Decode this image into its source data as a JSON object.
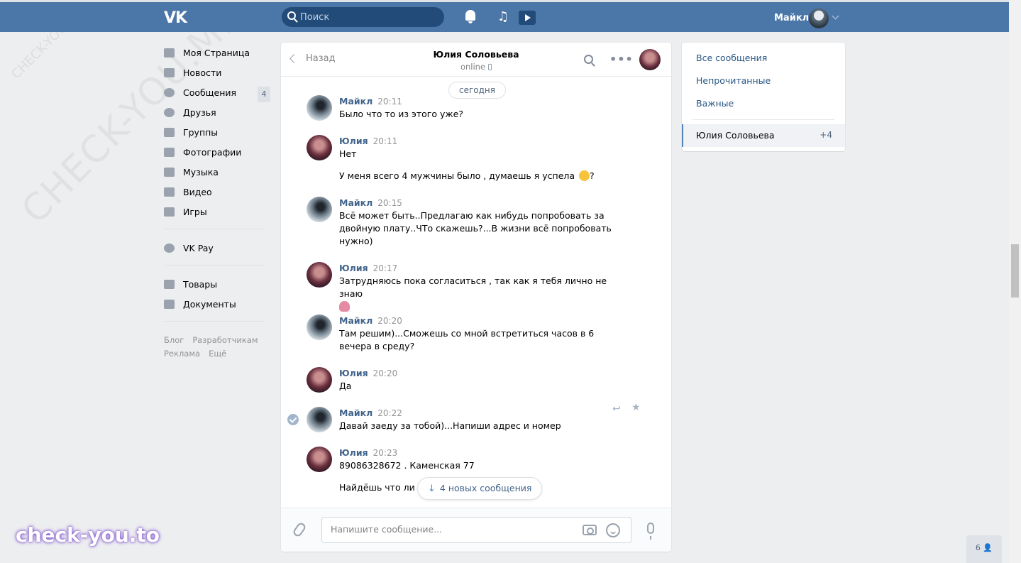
{
  "header": {
    "logo": "VK",
    "search_placeholder": "Поиск",
    "user_name": "Майкл",
    "icons": [
      "bell-icon",
      "music-icon",
      "player-icon"
    ]
  },
  "leftnav": {
    "items": [
      {
        "label": "Моя Страница",
        "icon": "home-icon"
      },
      {
        "label": "Новости",
        "icon": "news-icon"
      },
      {
        "label": "Сообщения",
        "icon": "messages-icon",
        "badge": "4"
      },
      {
        "label": "Друзья",
        "icon": "friends-icon"
      },
      {
        "label": "Группы",
        "icon": "groups-icon"
      },
      {
        "label": "Фотографии",
        "icon": "photo-icon"
      },
      {
        "label": "Музыка",
        "icon": "music-icon"
      },
      {
        "label": "Видео",
        "icon": "video-icon"
      },
      {
        "label": "Игры",
        "icon": "games-icon"
      },
      {
        "label": "VK Pay",
        "icon": "vkpay-icon"
      },
      {
        "label": "Товары",
        "icon": "goods-icon"
      },
      {
        "label": "Документы",
        "icon": "docs-icon"
      }
    ],
    "footer": [
      "Блог",
      "Разработчикам",
      "Реклама",
      "Ещё"
    ]
  },
  "chat": {
    "back_label": "Назад",
    "peer_name": "Юлия Соловьева",
    "peer_status": "online",
    "date_label": "сегодня",
    "messages": [
      {
        "author": "Майкл",
        "time": "20:11",
        "text": "Было что то из этого уже?"
      },
      {
        "author": "Юлия",
        "time": "20:11",
        "text": "Нет",
        "text2": "У меня всего 4 мужчины было , думаешь я успела",
        "text2_end": "?"
      },
      {
        "author": "Майкл",
        "time": "20:15",
        "text": "Всё может быть..Предлагаю как нибудь попробовать за двойную плату..ЧТо скажешь?...В жизни всё попробовать нужно)"
      },
      {
        "author": "Юлия",
        "time": "20:17",
        "text": "Затрудняюсь пока согласиться , так как я тебя лично не знаю"
      },
      {
        "author": "Майкл",
        "time": "20:20",
        "text": "Там решим)...Сможешь со мной встретиться часов в 6 вечера в среду?"
      },
      {
        "author": "Юлия",
        "time": "20:20",
        "text": "Да"
      },
      {
        "author": "Майкл",
        "time": "20:22",
        "text": "Давай заеду за тобой)...Напиши адрес и номер"
      },
      {
        "author": "Юлия",
        "time": "20:23",
        "text": "89086328672 . Каменская 77",
        "text2": "Найдёшь что ли са"
      }
    ],
    "new_messages_label": "4 новых сообщения",
    "composer_placeholder": "Напишите сообщение..."
  },
  "rightpanel": {
    "filters": [
      "Все сообщения",
      "Непрочитанные",
      "Важные"
    ],
    "active_chat": {
      "name": "Юлия Соловьева",
      "count": "+4"
    }
  },
  "online_count": "6",
  "watermarks": {
    "big": "CHECK-YOU.ME",
    "small": "CHECK-YOU.ME",
    "logo": "check-you.to"
  }
}
